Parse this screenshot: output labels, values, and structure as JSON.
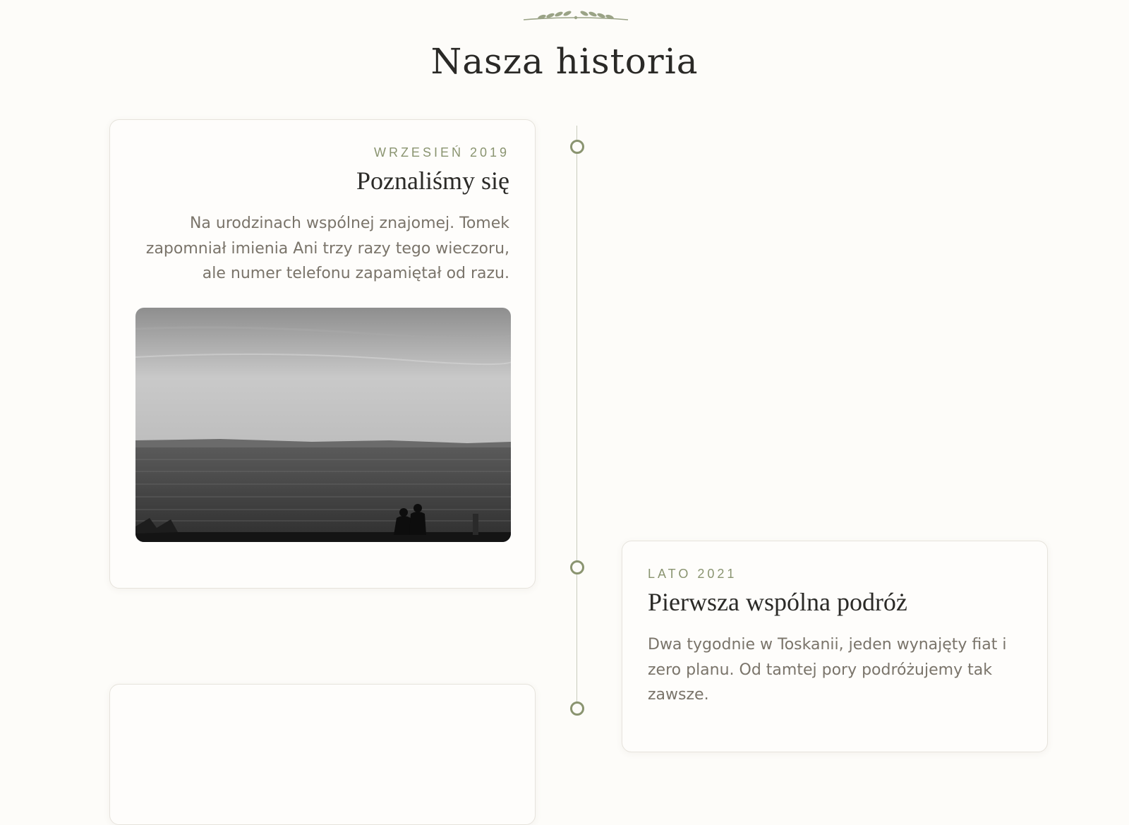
{
  "section": {
    "title": "Nasza historia"
  },
  "timeline": [
    {
      "date": "WRZESIEŃ 2019",
      "title": "Poznaliśmy się",
      "text": "Na urodzinach wspólnej znajomej. Tomek zapomniał imienia Ani trzy razy tego wieczoru, ale numer telefonu zapamiętał od razu.",
      "photo": "black-and-white photo of a couple sitting on a shore by the sea at dusk"
    },
    {
      "date": "LATO 2021",
      "title": "Pierwsza wspólna podróż",
      "text": "Dwa tygodnie w Toskanii, jeden wynajęty fiat i zero planu. Od tamtej pory podróżujemy tak zawsze."
    }
  ],
  "colors": {
    "background": "#fdfcf9",
    "accent": "#8a9470",
    "line": "#c9cbbd",
    "text_muted": "#7a746a",
    "heading": "#2b2a27"
  },
  "icons": {
    "ornament": "laurel-ornament-icon",
    "marker": "timeline-dot-icon"
  }
}
